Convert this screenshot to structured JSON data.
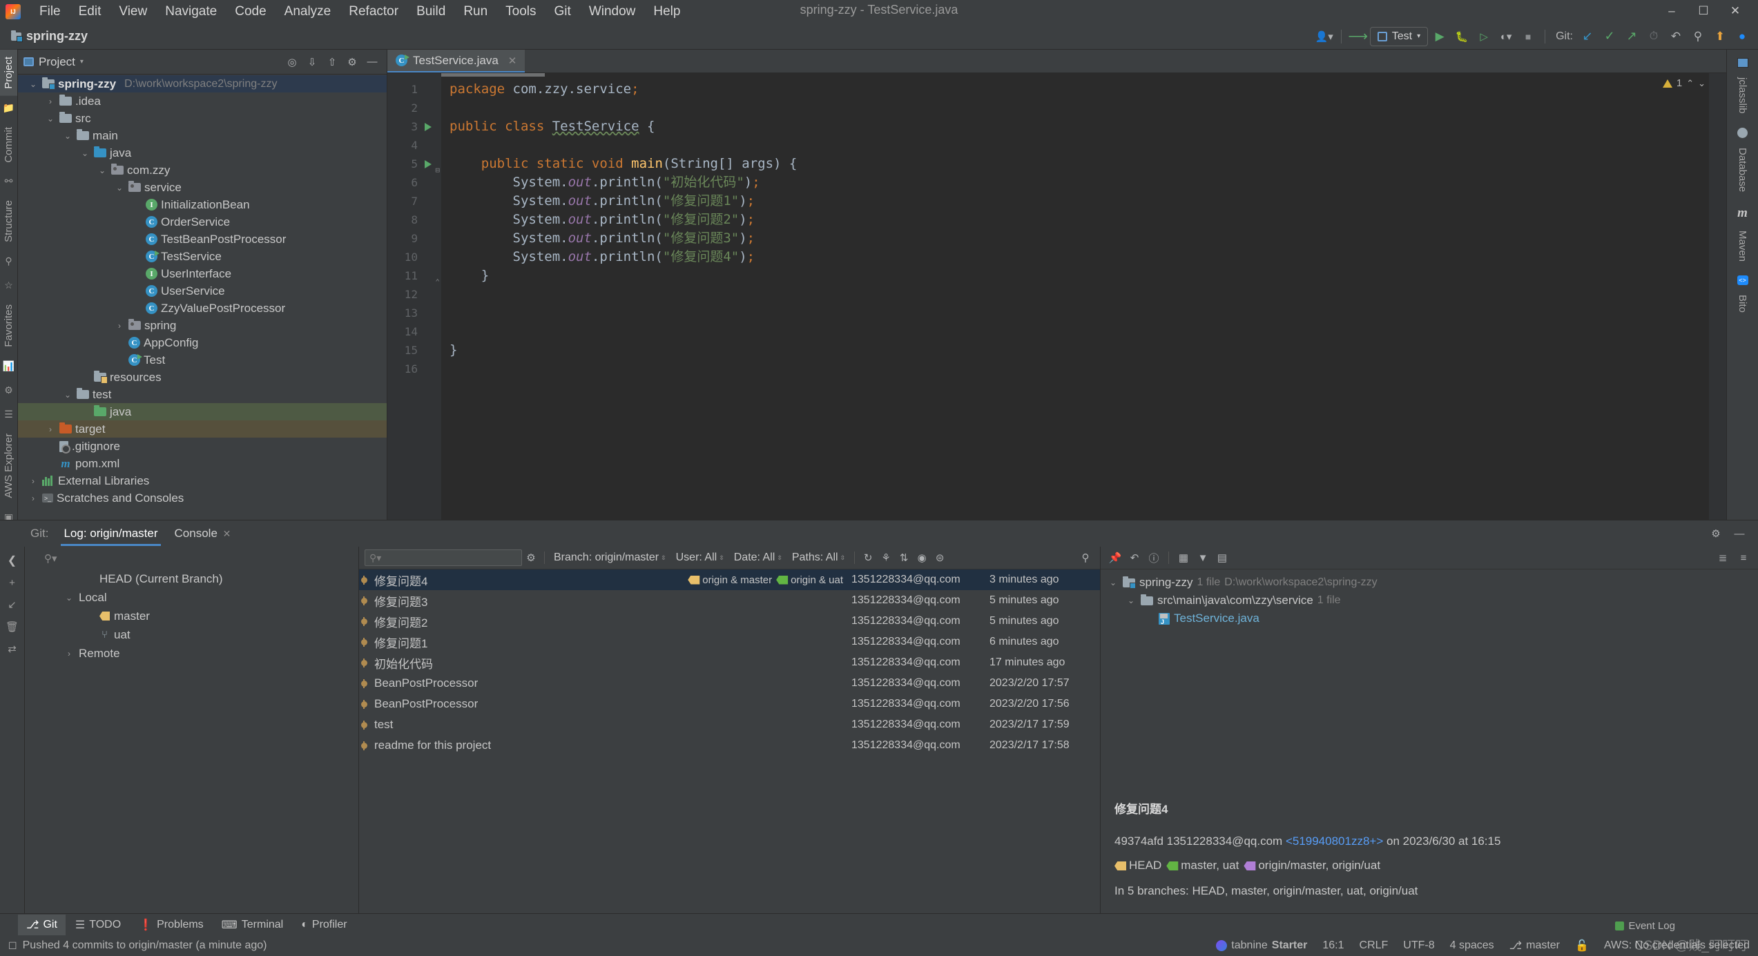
{
  "window": {
    "title": "spring-zzy - TestService.java",
    "project_label": "spring-zzy",
    "minimize": "–",
    "maximize": "☐",
    "close": "✕"
  },
  "menu": {
    "items": [
      "File",
      "Edit",
      "View",
      "Navigate",
      "Code",
      "Analyze",
      "Refactor",
      "Build",
      "Run",
      "Tools",
      "Git",
      "Window",
      "Help"
    ]
  },
  "toolbar": {
    "run_config": "Test",
    "git_label": "Git:",
    "icons": [
      {
        "name": "user-avatar-icon",
        "glyph": "👤"
      },
      {
        "name": "update-project-icon",
        "glyph": "↖"
      },
      {
        "name": "run-icon",
        "glyph": "▶"
      },
      {
        "name": "debug-icon",
        "glyph": "🐞"
      },
      {
        "name": "run-with-coverage-icon",
        "glyph": "▷"
      },
      {
        "name": "profile-icon",
        "glyph": "◔"
      },
      {
        "name": "stop-icon",
        "glyph": "■"
      },
      {
        "name": "git-update-icon",
        "glyph": "↙"
      },
      {
        "name": "git-commit-icon",
        "glyph": "✓"
      },
      {
        "name": "git-push-icon",
        "glyph": "↗"
      },
      {
        "name": "git-history-icon",
        "glyph": "◴"
      },
      {
        "name": "git-rollback-icon",
        "glyph": "↶"
      },
      {
        "name": "search-everywhere-icon",
        "glyph": "⌕"
      },
      {
        "name": "notification-icon",
        "glyph": "⬆"
      },
      {
        "name": "bito-icon",
        "glyph": "◕"
      }
    ]
  },
  "left_strip": {
    "top": [
      "Project",
      "Commit"
    ],
    "bottom": [
      "Structure",
      "Favorites",
      "AWS Explorer"
    ]
  },
  "right_strip": {
    "items": [
      "jclasslib",
      "Database",
      "Maven",
      "Bito"
    ]
  },
  "project_panel": {
    "title": "Project",
    "header_icons": [
      "locate-icon",
      "expand-all-icon",
      "collapse-all-icon",
      "settings-gear-icon",
      "hide-icon"
    ],
    "tree": [
      {
        "label": "spring-zzy",
        "path": "D:\\work\\workspace2\\spring-zzy",
        "depth": 0,
        "arrow": "⌄",
        "icon": "module",
        "bold": true,
        "state": "sel-blue"
      },
      {
        "label": ".idea",
        "path": "",
        "depth": 1,
        "arrow": "›",
        "icon": "folder",
        "bold": false,
        "state": ""
      },
      {
        "label": "src",
        "path": "",
        "depth": 1,
        "arrow": "⌄",
        "icon": "folder",
        "bold": false,
        "state": ""
      },
      {
        "label": "main",
        "path": "",
        "depth": 2,
        "arrow": "⌄",
        "icon": "folder",
        "bold": false,
        "state": ""
      },
      {
        "label": "java",
        "path": "",
        "depth": 3,
        "arrow": "⌄",
        "icon": "folder-blue",
        "bold": false,
        "state": ""
      },
      {
        "label": "com.zzy",
        "path": "",
        "depth": 4,
        "arrow": "⌄",
        "icon": "pkg",
        "bold": false,
        "state": ""
      },
      {
        "label": "service",
        "path": "",
        "depth": 5,
        "arrow": "⌄",
        "icon": "pkg",
        "bold": false,
        "state": ""
      },
      {
        "label": "InitializationBean",
        "path": "",
        "depth": 6,
        "arrow": "",
        "icon": "iface",
        "bold": false,
        "state": ""
      },
      {
        "label": "OrderService",
        "path": "",
        "depth": 6,
        "arrow": "",
        "icon": "cls",
        "bold": false,
        "state": ""
      },
      {
        "label": "TestBeanPostProcessor",
        "path": "",
        "depth": 6,
        "arrow": "",
        "icon": "cls",
        "bold": false,
        "state": ""
      },
      {
        "label": "TestService",
        "path": "",
        "depth": 6,
        "arrow": "",
        "icon": "cls-run",
        "bold": false,
        "state": ""
      },
      {
        "label": "UserInterface",
        "path": "",
        "depth": 6,
        "arrow": "",
        "icon": "iface",
        "bold": false,
        "state": ""
      },
      {
        "label": "UserService",
        "path": "",
        "depth": 6,
        "arrow": "",
        "icon": "cls",
        "bold": false,
        "state": ""
      },
      {
        "label": "ZzyValuePostProcessor",
        "path": "",
        "depth": 6,
        "arrow": "",
        "icon": "cls",
        "bold": false,
        "state": ""
      },
      {
        "label": "spring",
        "path": "",
        "depth": 5,
        "arrow": "›",
        "icon": "pkg",
        "bold": false,
        "state": ""
      },
      {
        "label": "AppConfig",
        "path": "",
        "depth": 5,
        "arrow": "",
        "icon": "cls",
        "bold": false,
        "state": ""
      },
      {
        "label": "Test",
        "path": "",
        "depth": 5,
        "arrow": "",
        "icon": "cls-run",
        "bold": false,
        "state": ""
      },
      {
        "label": "resources",
        "path": "",
        "depth": 3,
        "arrow": "",
        "icon": "folder-res",
        "bold": false,
        "state": ""
      },
      {
        "label": "test",
        "path": "",
        "depth": 2,
        "arrow": "⌄",
        "icon": "folder",
        "bold": false,
        "state": ""
      },
      {
        "label": "java",
        "path": "",
        "depth": 3,
        "arrow": "",
        "icon": "folder-green",
        "bold": false,
        "state": "sel-green"
      },
      {
        "label": "target",
        "path": "",
        "depth": 1,
        "arrow": "›",
        "icon": "folder-orange",
        "bold": false,
        "state": "sel-brown"
      },
      {
        "label": ".gitignore",
        "path": "",
        "depth": 1,
        "arrow": "",
        "icon": "gitignore",
        "bold": false,
        "state": ""
      },
      {
        "label": "pom.xml",
        "path": "",
        "depth": 1,
        "arrow": "",
        "icon": "maven",
        "bold": false,
        "state": ""
      },
      {
        "label": "External Libraries",
        "path": "",
        "depth": 0,
        "arrow": "›",
        "icon": "lib",
        "bold": false,
        "state": ""
      },
      {
        "label": "Scratches and Consoles",
        "path": "",
        "depth": 0,
        "arrow": "›",
        "icon": "scratch",
        "bold": false,
        "state": ""
      }
    ]
  },
  "editor": {
    "tab": {
      "label": "TestService.java",
      "close": "✕"
    },
    "warning_count": "1",
    "warning_nav_up": "⌃",
    "warning_nav_down": "⌄",
    "line_numbers": [
      "1",
      "2",
      "3",
      "4",
      "5",
      "6",
      "7",
      "8",
      "9",
      "10",
      "11",
      "12",
      "13",
      "14",
      "15",
      "16"
    ],
    "lines": [
      {
        "n": 1,
        "html": "<span class=\"kw\">package</span> <span class=\"pln\">com.zzy.service</span><span class=\"kw\">;</span>"
      },
      {
        "n": 2,
        "html": ""
      },
      {
        "n": 3,
        "html": "<span class=\"kw\">public class</span> <span class=\"cls-n\">TestService</span> <span class=\"pln\">{</span>",
        "gutter_run": true
      },
      {
        "n": 4,
        "html": ""
      },
      {
        "n": 5,
        "html": "    <span class=\"kw\">public static void</span> <span class=\"fn\">main</span><span class=\"pln\">(String[] args) {</span>",
        "gutter_run": true,
        "gutter_fold": "⊟"
      },
      {
        "n": 6,
        "html": "        <span class=\"pln\">System.</span><span class=\"fld\">out</span><span class=\"pln\">.println(</span><span class=\"str\">\"初始化代码\"</span><span class=\"pln\">)</span><span class=\"kw\">;</span>"
      },
      {
        "n": 7,
        "html": "        <span class=\"pln\">System.</span><span class=\"fld\">out</span><span class=\"pln\">.println(</span><span class=\"str\">\"修复问题1\"</span><span class=\"pln\">)</span><span class=\"kw\">;</span>"
      },
      {
        "n": 8,
        "html": "        <span class=\"pln\">System.</span><span class=\"fld\">out</span><span class=\"pln\">.println(</span><span class=\"str\">\"修复问题2\"</span><span class=\"pln\">)</span><span class=\"kw\">;</span>"
      },
      {
        "n": 9,
        "html": "        <span class=\"pln\">System.</span><span class=\"fld\">out</span><span class=\"pln\">.println(</span><span class=\"str\">\"修复问题3\"</span><span class=\"pln\">)</span><span class=\"kw\">;</span>"
      },
      {
        "n": 10,
        "html": "        <span class=\"pln\">System.</span><span class=\"fld\">out</span><span class=\"pln\">.println(</span><span class=\"str\">\"修复问题4\"</span><span class=\"pln\">)</span><span class=\"kw\">;</span>"
      },
      {
        "n": 11,
        "html": "    <span class=\"pln\">}</span>",
        "gutter_fold": "⌃"
      },
      {
        "n": 12,
        "html": ""
      },
      {
        "n": 13,
        "html": ""
      },
      {
        "n": 14,
        "html": ""
      },
      {
        "n": 15,
        "html": "<span class=\"pln\">}</span>"
      },
      {
        "n": 16,
        "html": ""
      }
    ]
  },
  "git_window": {
    "label": "Git:",
    "tabs": [
      {
        "label": "Log: origin/master",
        "active": true,
        "closable": false
      },
      {
        "label": "Console",
        "active": false,
        "closable": true,
        "close": "✕"
      }
    ],
    "tab_settings_icon": "gear-icon",
    "tab_hide_icon": "minimize-icon",
    "branches_search_placeholder": "",
    "branch_tree": [
      {
        "label": "HEAD (Current Branch)",
        "depth": 1,
        "arrow": "",
        "icon": "none"
      },
      {
        "label": "Local",
        "depth": 0,
        "arrow": "⌄",
        "icon": "none"
      },
      {
        "label": "master",
        "depth": 1,
        "arrow": "",
        "icon": "tag"
      },
      {
        "label": "uat",
        "depth": 1,
        "arrow": "",
        "icon": "branch"
      },
      {
        "label": "Remote",
        "depth": 0,
        "arrow": "›",
        "icon": "none"
      }
    ],
    "side_icons": [
      "collapse-icon",
      "add-icon",
      "fetch-icon",
      "delete-icon",
      "merge-icon"
    ],
    "filters": {
      "search_placeholder": "",
      "settings_icon": "gear-icon",
      "branch": "Branch: origin/master",
      "user": "User: All",
      "date": "Date: All",
      "paths": "Paths: All",
      "action_icons": [
        "refresh-icon",
        "intellisort-icon",
        "sort-icon",
        "highlight-icon",
        "expand-icon"
      ],
      "right_icons": [
        "search-icon",
        "go-to-hash-icon"
      ]
    },
    "commit_columns": [
      "message",
      "author",
      "date"
    ],
    "commits": [
      {
        "message": "修复问题4",
        "author": "1351228334@qq.com",
        "date": "3 minutes ago",
        "selected": true,
        "refs": [
          {
            "text": "origin & master",
            "color": "yellow",
            "double": true
          },
          {
            "text": "origin & uat",
            "color": "green",
            "double": true
          }
        ]
      },
      {
        "message": "修复问题3",
        "author": "1351228334@qq.com",
        "date": "5 minutes ago",
        "selected": false,
        "refs": []
      },
      {
        "message": "修复问题2",
        "author": "1351228334@qq.com",
        "date": "5 minutes ago",
        "selected": false,
        "refs": []
      },
      {
        "message": "修复问题1",
        "author": "1351228334@qq.com",
        "date": "6 minutes ago",
        "selected": false,
        "refs": []
      },
      {
        "message": "初始化代码",
        "author": "1351228334@qq.com",
        "date": "17 minutes ago",
        "selected": false,
        "refs": []
      },
      {
        "message": "BeanPostProcessor",
        "author": "1351228334@qq.com",
        "date": "2023/2/20 17:57",
        "selected": false,
        "refs": []
      },
      {
        "message": "BeanPostProcessor",
        "author": "1351228334@qq.com",
        "date": "2023/2/20 17:56",
        "selected": false,
        "refs": []
      },
      {
        "message": "test",
        "author": "1351228334@qq.com",
        "date": "2023/2/17 17:59",
        "selected": false,
        "refs": []
      },
      {
        "message": "readme for this project",
        "author": "1351228334@qq.com",
        "date": "2023/2/17 17:58",
        "selected": false,
        "refs": []
      }
    ],
    "details": {
      "toolbar_icons": [
        "pin-icon",
        "revert-icon",
        "info-icon",
        "group-by-module-icon",
        "filter-icon",
        "group-by-directory-icon"
      ],
      "right_icons": [
        "expand-all-icon",
        "collapse-all-icon"
      ],
      "files": [
        {
          "label": "spring-zzy",
          "count": "1 file",
          "path": "D:\\work\\workspace2\\spring-zzy",
          "depth": 0,
          "arrow": "⌄",
          "icon": "module"
        },
        {
          "label": "src\\main\\java\\com\\zzy\\service",
          "count": "1 file",
          "path": "",
          "depth": 1,
          "arrow": "⌄",
          "icon": "folder"
        },
        {
          "label": "TestService.java",
          "count": "",
          "path": "",
          "depth": 2,
          "arrow": "",
          "icon": "java"
        }
      ],
      "commit_title": "修复问题4",
      "commit_hash": "49374afd",
      "commit_author": "1351228334@qq.com",
      "commit_email_link": "<519940801zz8+>",
      "commit_on": "on 2023/6/30 at 16:15",
      "refs": [
        {
          "text": "HEAD",
          "color": "yellow",
          "double": false
        },
        {
          "text": "master, uat",
          "color": "green",
          "double": true
        },
        {
          "text": "origin/master, origin/uat",
          "color": "purple",
          "double": true
        }
      ],
      "branches_line": "In 5 branches: HEAD, master, origin/master, uat, origin/uat"
    }
  },
  "bottom_bar": {
    "tabs": [
      {
        "label": "Git",
        "icon": "git-branch-icon",
        "active": true
      },
      {
        "label": "TODO",
        "icon": "list-icon",
        "active": false
      },
      {
        "label": "Problems",
        "icon": "error-icon",
        "active": false
      },
      {
        "label": "Terminal",
        "icon": "terminal-icon",
        "active": false
      },
      {
        "label": "Profiler",
        "icon": "profiler-icon",
        "active": false
      }
    ]
  },
  "status_bar": {
    "message": "Pushed 4 commits to origin/master (a minute ago)",
    "event_log": "Event Log",
    "tabnine": "tabnine",
    "tabnine_plan": "Starter",
    "caret": "16:1",
    "line_sep": "CRLF",
    "encoding": "UTF-8",
    "indent": "4 spaces",
    "branch": "master",
    "lock_icon": "lock-icon",
    "aws": "AWS: No credentials selected",
    "watermark": "CSDN @贱_叮叮叮"
  }
}
